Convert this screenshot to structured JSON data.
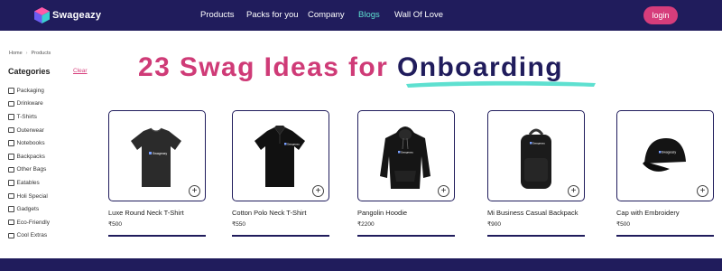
{
  "header": {
    "brand": "Swageazy",
    "nav": [
      "Products",
      "Packs for you",
      "Company",
      "Blogs",
      "Wall Of Love"
    ],
    "active_nav": "Blogs",
    "login_label": "login"
  },
  "breadcrumb": [
    "Home",
    "Products"
  ],
  "sidebar": {
    "title": "Categories",
    "clear_label": "Clear",
    "categories": [
      "Packaging",
      "Drinkware",
      "T-Shirts",
      "Outerwear",
      "Notebooks",
      "Backpacks",
      "Other Bags",
      "Eatables",
      "Holi Special",
      "Gadgets",
      "Eco-Friendly",
      "Cool Extras"
    ]
  },
  "title": {
    "part1": "23 Swag Ideas for",
    "part2": "Onboarding"
  },
  "products": [
    {
      "name": "Luxe Round Neck T-Shirt",
      "price": "₹500",
      "icon": "tshirt-icon"
    },
    {
      "name": "Cotton Polo Neck T-Shirt",
      "price": "₹550",
      "icon": "polo-shirt-icon"
    },
    {
      "name": "Pangolin Hoodie",
      "price": "₹2200",
      "icon": "hoodie-icon"
    },
    {
      "name": "Mi Business Casual Backpack",
      "price": "₹900",
      "icon": "backpack-icon"
    },
    {
      "name": "Cap with Embroidery",
      "price": "₹500",
      "icon": "cap-icon"
    }
  ],
  "product_label_logo": "Swageazy",
  "colors": {
    "navy": "#201c5c",
    "pink": "#cf3b77",
    "teal": "#5ee0d0"
  }
}
